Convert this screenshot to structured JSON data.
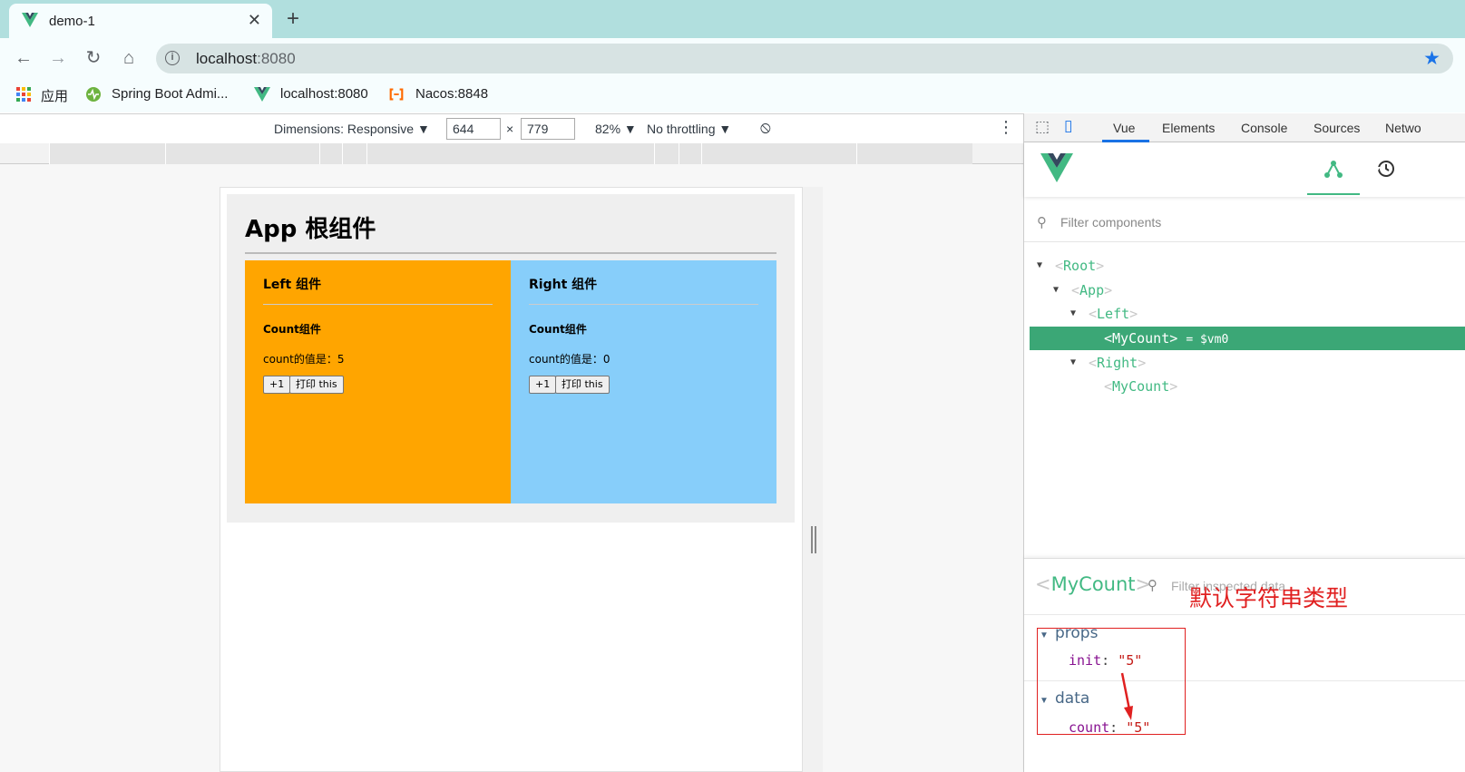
{
  "browser": {
    "tab_title": "demo-1",
    "tab_close": "✕",
    "new_tab": "+",
    "url_host": "localhost",
    "url_port": ":8080",
    "bookmarks": [
      {
        "label": "应用"
      },
      {
        "label": "Spring Boot Admi..."
      },
      {
        "label": "localhost:8080"
      },
      {
        "label": "Nacos:8848"
      }
    ]
  },
  "device_toolbar": {
    "dimensions_label": "Dimensions: Responsive ▼",
    "width": "644",
    "times": "×",
    "height": "779",
    "zoom": "82% ▼",
    "throttling": "No throttling ▼"
  },
  "page": {
    "title": "App 根组件",
    "left": {
      "heading": "Left 组件",
      "count_heading": "Count组件",
      "count_text": "count的值是：5",
      "plus_label": "+1",
      "print_label": "打印 this"
    },
    "right": {
      "heading": "Right 组件",
      "count_heading": "Count组件",
      "count_text": "count的值是：0",
      "plus_label": "+1",
      "print_label": "打印 this"
    }
  },
  "devtools": {
    "tabs": [
      "Vue",
      "Elements",
      "Console",
      "Sources",
      "Netwo"
    ],
    "active_tab": "Vue",
    "filter_placeholder": "Filter components",
    "tree": [
      {
        "name": "Root",
        "expanded": true
      },
      {
        "name": "App",
        "expanded": true
      },
      {
        "name": "Left",
        "expanded": true
      },
      {
        "name": "MyCount",
        "selected": true,
        "ref": "= $vm0"
      },
      {
        "name": "Right",
        "expanded": true
      },
      {
        "name": "MyCount"
      }
    ],
    "inspector": {
      "component": "MyCount",
      "filter_placeholder": "Filter inspected data",
      "props_label": "props",
      "props": [
        {
          "key": "init",
          "value": "\"5\""
        }
      ],
      "data_label": "data",
      "data": [
        {
          "key": "count",
          "value": "\"5\""
        }
      ]
    },
    "annotation": "默认字符串类型"
  },
  "colors": {
    "left_panel": "#ffa500",
    "right_panel": "#87cefa",
    "vue_green": "#42b983",
    "annotation_red": "#e02020"
  }
}
